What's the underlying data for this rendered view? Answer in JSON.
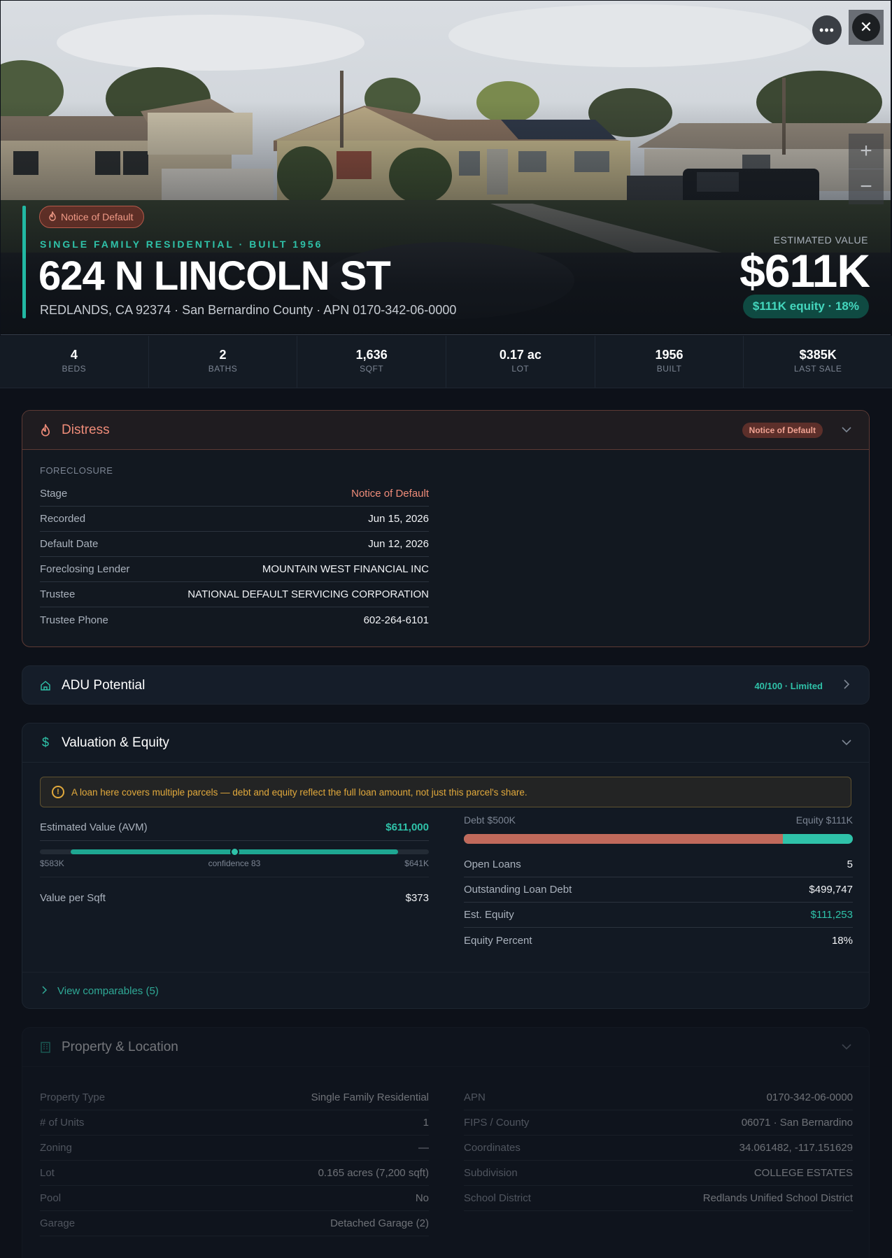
{
  "hero": {
    "tag": "Notice of Default",
    "type_line": "SINGLE FAMILY RESIDENTIAL · BUILT 1956",
    "address": "624 N LINCOLN ST",
    "subline": "REDLANDS, CA 92374 · San Bernardino County · APN 0170-342-06-0000",
    "est_label": "ESTIMATED VALUE",
    "est_value": "$611K",
    "equity_pill": "$111K equity · 18%",
    "more_icon": "ellipsis-icon",
    "close_icon": "close-icon",
    "zoom_in": "+",
    "zoom_out": "−"
  },
  "stats": [
    {
      "value": "4",
      "label": "BEDS"
    },
    {
      "value": "2",
      "label": "BATHS"
    },
    {
      "value": "1,636",
      "label": "SQFT"
    },
    {
      "value": "0.17 ac",
      "label": "LOT"
    },
    {
      "value": "1956",
      "label": "BUILT"
    },
    {
      "value": "$385K",
      "label": "LAST SALE"
    }
  ],
  "distress": {
    "title": "Distress",
    "badge": "Notice of Default",
    "section": "FORECLOSURE",
    "rows": [
      {
        "k": "Stage",
        "v": "Notice of Default"
      },
      {
        "k": "Recorded",
        "v": "Jun 15, 2026"
      },
      {
        "k": "Default Date",
        "v": "Jun 12, 2026"
      },
      {
        "k": "Foreclosing Lender",
        "v": "MOUNTAIN WEST FINANCIAL INC"
      },
      {
        "k": "Trustee",
        "v": "NATIONAL DEFAULT SERVICING CORPORATION"
      },
      {
        "k": "Trustee Phone",
        "v": "602-264-6101"
      }
    ],
    "colors": {
      "accent": "#ef8c79",
      "border": "#5d3a34"
    }
  },
  "adu": {
    "title": "ADU Potential",
    "score": "40/100 · Limited"
  },
  "valuation": {
    "title": "Valuation & Equity",
    "warning": "A loan here covers multiple parcels — debt and equity reflect the full loan amount, not just this parcel's share.",
    "avm_label": "Estimated Value (AVM)",
    "avm_value": "$611,000",
    "range_low": "$583K",
    "range_conf": "confidence 83",
    "range_high": "$641K",
    "range_fill_start_pct": 8,
    "range_fill_end_pct": 92,
    "range_dot_pct": 50,
    "vps_label": "Value per Sqft",
    "vps_value": "$373",
    "debt_label": "Debt $500K",
    "equity_label": "Equity $111K",
    "debt_share_pct": 82,
    "rows": [
      {
        "k": "Open Loans",
        "v": "5"
      },
      {
        "k": "Outstanding Loan Debt",
        "v": "$499,747"
      },
      {
        "k": "Est. Equity",
        "v": "$111,253"
      },
      {
        "k": "Equity Percent",
        "v": "18%"
      }
    ],
    "comparables": "View comparables (5)"
  },
  "property": {
    "title": "Property & Location",
    "left": [
      {
        "k": "Property Type",
        "v": "Single Family Residential"
      },
      {
        "k": "# of Units",
        "v": "1"
      },
      {
        "k": "Zoning",
        "v": "—"
      },
      {
        "k": "Lot",
        "v": "0.165 acres (7,200 sqft)"
      },
      {
        "k": "Pool",
        "v": "No"
      },
      {
        "k": "Garage",
        "v": "Detached Garage (2)"
      }
    ],
    "right": [
      {
        "k": "APN",
        "v": "0170-342-06-0000"
      },
      {
        "k": "FIPS / County",
        "v": "06071 · San Bernardino"
      },
      {
        "k": "Coordinates",
        "v": "34.061482, -117.151629"
      },
      {
        "k": "Subdivision",
        "v": "COLLEGE ESTATES"
      },
      {
        "k": "School District",
        "v": "Redlands Unified School District"
      }
    ]
  },
  "colors": {
    "teal": "#2fc2a9",
    "background": "#0d1119",
    "card": "#121923"
  }
}
